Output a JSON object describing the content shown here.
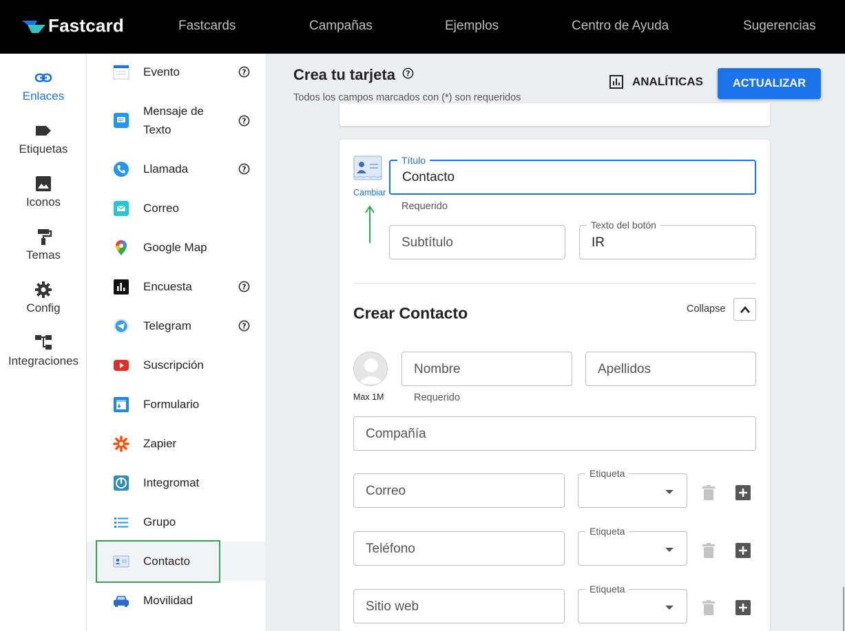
{
  "nav": {
    "brand": "Fastcard",
    "items": [
      "Fastcards",
      "Campañas",
      "Ejemplos",
      "Centro de Ayuda",
      "Sugerencias"
    ]
  },
  "rail": {
    "items": [
      {
        "label": "Enlaces",
        "icon": "link-icon",
        "active": true
      },
      {
        "label": "Etiquetas",
        "icon": "label-icon"
      },
      {
        "label": "Iconos",
        "icon": "image-icon"
      },
      {
        "label": "Temas",
        "icon": "paint-roller-icon"
      },
      {
        "label": "Config",
        "icon": "gear-icon"
      },
      {
        "label": "Integraciones",
        "icon": "integration-tree-icon"
      }
    ]
  },
  "components": [
    {
      "label": "Evento",
      "help": true
    },
    {
      "label": "Mensaje de Texto",
      "help": true
    },
    {
      "label": "Llamada",
      "help": true
    },
    {
      "label": "Correo",
      "help": false
    },
    {
      "label": "Google Map",
      "help": false
    },
    {
      "label": "Encuesta",
      "help": true
    },
    {
      "label": "Telegram",
      "help": true
    },
    {
      "label": "Suscripción",
      "help": false
    },
    {
      "label": "Formulario",
      "help": false
    },
    {
      "label": "Zapier",
      "help": false
    },
    {
      "label": "Integromat",
      "help": false
    },
    {
      "label": "Grupo",
      "help": false
    },
    {
      "label": "Contacto",
      "help": false,
      "selected": true
    },
    {
      "label": "Movilidad",
      "help": false
    }
  ],
  "header": {
    "title": "Crea tu tarjeta",
    "subtitle": "Todos los campos marcados con (*) son requeridos",
    "analytics_label": "ANALÍTICAS",
    "update_label": "ACTUALIZAR"
  },
  "card": {
    "change_label": "Cambiar",
    "title_label": "Título",
    "title_value": "Contacto",
    "title_helper": "Requerido",
    "subtitle_placeholder": "Subtítulo",
    "button_text_label": "Texto del botón",
    "button_text_value": "IR"
  },
  "contact": {
    "section_title": "Crear Contacto",
    "collapse_label": "Collapse",
    "avatar_limit": "Max 1M",
    "first_name_placeholder": "Nombre",
    "first_name_helper": "Requerido",
    "last_name_placeholder": "Apellidos",
    "company_placeholder": "Compañía",
    "rows": [
      {
        "placeholder": "Correo",
        "select_label": "Etiqueta"
      },
      {
        "placeholder": "Teléfono",
        "select_label": "Etiqueta"
      },
      {
        "placeholder": "Sitio web",
        "select_label": "Etiqueta"
      }
    ]
  },
  "colors": {
    "accent": "#1a73e8",
    "highlight": "#2fa84f",
    "topbar": "#000000"
  }
}
